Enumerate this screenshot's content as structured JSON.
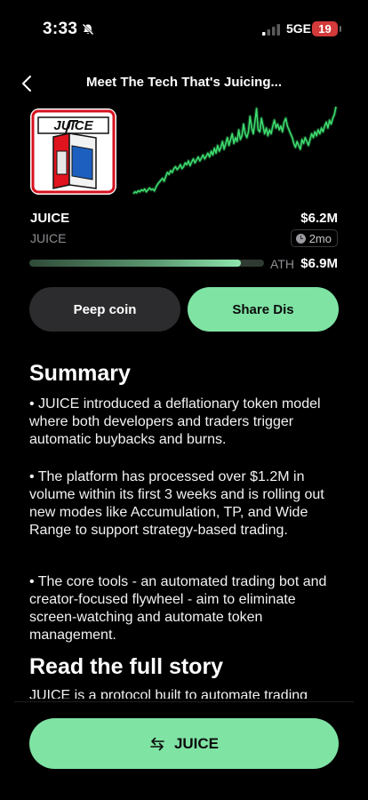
{
  "status_bar": {
    "time": "3:33",
    "network": "5GE",
    "battery": "19"
  },
  "header": {
    "title": "Meet The Tech That's Juicing..."
  },
  "coin": {
    "logo_text": "JUICE",
    "name": "JUICE",
    "ticker": "JUICE",
    "market_cap": "$6.2M",
    "age": "2mo",
    "ath_label": "ATH",
    "ath_value": "$6.9M",
    "progress": 0.9,
    "chart_color": "#3ddc6e",
    "chart_values": [
      8,
      10,
      9,
      11,
      10,
      12,
      11,
      13,
      10,
      12,
      14,
      12,
      13,
      11,
      15,
      18,
      20,
      22,
      24,
      21,
      26,
      30,
      28,
      32,
      30,
      34,
      36,
      33,
      35,
      38,
      34,
      36,
      40,
      38,
      42,
      37,
      41,
      44,
      40,
      43,
      46,
      42,
      45,
      48,
      44,
      47,
      50,
      46,
      52,
      48,
      55,
      50,
      58,
      52,
      56,
      62,
      54,
      60,
      66,
      58,
      64,
      70,
      60,
      66,
      62,
      74,
      64,
      68,
      80,
      70,
      66,
      72,
      88,
      76,
      70,
      82,
      96,
      74,
      72,
      86,
      78,
      70,
      76,
      68,
      74,
      70,
      78,
      84,
      76,
      80,
      74,
      78,
      72,
      82,
      86,
      78,
      74,
      70,
      66,
      60,
      56,
      62,
      58,
      54,
      64,
      60,
      66,
      62,
      58,
      64,
      70,
      66,
      72,
      68,
      74,
      70,
      76,
      72,
      78,
      82,
      76,
      84,
      80,
      86,
      90,
      98
    ]
  },
  "actions": {
    "peep_label": "Peep coin",
    "share_label": "Share Dis",
    "trade_label": "JUICE"
  },
  "summary": {
    "title": "Summary",
    "points": [
      "• JUICE introduced a deflationary token model where both developers and traders trigger automatic buybacks and burns.",
      "• The platform has processed over $1.2M in volume within its first 3 weeks and is rolling out new modes like Accumulation, TP, and Wide Range to support strategy-based trading.",
      "• The core tools - an automated trading bot and creator-focused flywheel - aim to eliminate screen-watching and automate token management."
    ]
  },
  "full_story": {
    "title": "Read the full story",
    "text": "JUICE is a protocol built to automate trading"
  }
}
